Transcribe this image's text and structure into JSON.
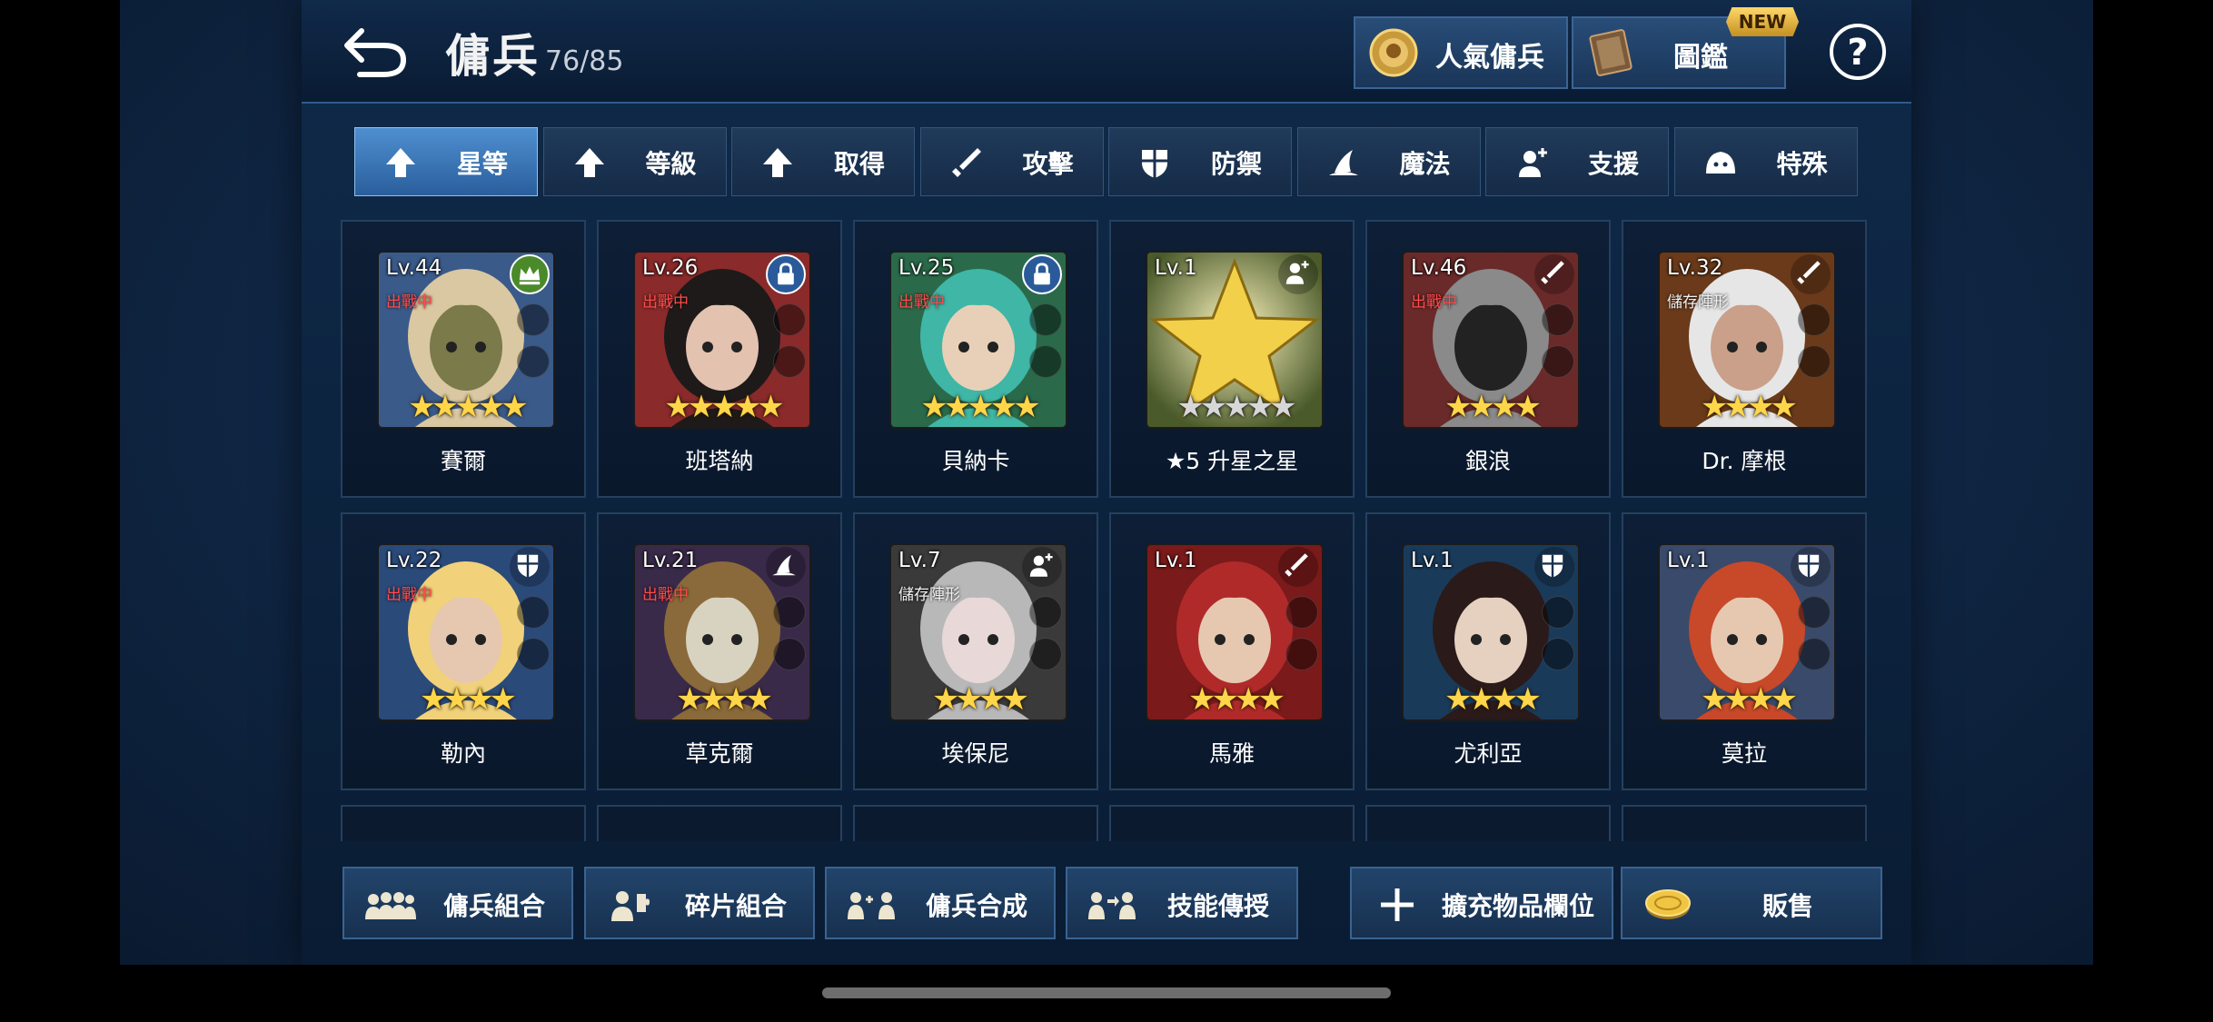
{
  "header": {
    "title": "傭兵",
    "count": "76/85"
  },
  "top_buttons": {
    "popular": "人氣傭兵",
    "codex": "圖鑑",
    "new_badge": "NEW",
    "help": "?"
  },
  "filters": [
    {
      "label": "星等",
      "icon": "arrow-up-icon",
      "active": true
    },
    {
      "label": "等級",
      "icon": "arrow-up-icon"
    },
    {
      "label": "取得",
      "icon": "arrow-up-icon"
    },
    {
      "label": "攻擊",
      "icon": "sword-icon"
    },
    {
      "label": "防禦",
      "icon": "shield-icon"
    },
    {
      "label": "魔法",
      "icon": "wizard-hat-icon"
    },
    {
      "label": "支援",
      "icon": "support-icon"
    },
    {
      "label": "特殊",
      "icon": "slime-icon"
    }
  ],
  "cards": [
    {
      "name": "賽爾",
      "level": "Lv.44",
      "status": "出戰中",
      "stars": "★★★★★",
      "badge": "crown-icon"
    },
    {
      "name": "班塔納",
      "level": "Lv.26",
      "status": "出戰中",
      "stars": "★★★★★",
      "badge": "lock-icon"
    },
    {
      "name": "貝納卡",
      "level": "Lv.25",
      "status": "出戰中",
      "stars": "★★★★★",
      "badge": "lock-icon"
    },
    {
      "name": "★5 升星之星",
      "level": "Lv.1",
      "status": "",
      "stars": "★★★★★",
      "badge": "support-icon"
    },
    {
      "name": "銀浪",
      "level": "Lv.46",
      "status": "出戰中",
      "stars": "★★★★",
      "badge": "sword-icon"
    },
    {
      "name": "Dr. 摩根",
      "level": "Lv.32",
      "status": "儲存陣形",
      "stars": "★★★★",
      "badge": "sword-icon"
    },
    {
      "name": "勒內",
      "level": "Lv.22",
      "status": "出戰中",
      "stars": "★★★★",
      "badge": "shield-icon"
    },
    {
      "name": "草克爾",
      "level": "Lv.21",
      "status": "出戰中",
      "stars": "★★★★",
      "badge": "wizard-hat-icon"
    },
    {
      "name": "埃保尼",
      "level": "Lv.7",
      "status": "儲存陣形",
      "stars": "★★★★",
      "badge": "support-icon"
    },
    {
      "name": "馬雅",
      "level": "Lv.1",
      "status": "",
      "stars": "★★★★",
      "badge": "sword-icon"
    },
    {
      "name": "尤利亞",
      "level": "Lv.1",
      "status": "",
      "stars": "★★★★",
      "badge": "shield-icon"
    },
    {
      "name": "莫拉",
      "level": "Lv.1",
      "status": "",
      "stars": "★★★★",
      "badge": "shield-icon"
    }
  ],
  "bottom_buttons": [
    {
      "label": "傭兵組合",
      "icon": "group-icon"
    },
    {
      "label": "碎片組合",
      "icon": "puzzle-icon"
    },
    {
      "label": "傭兵合成",
      "icon": "merge-icon"
    },
    {
      "label": "技能傳授",
      "icon": "skill-transfer-icon"
    },
    {
      "label": "擴充物品欄位",
      "icon": "plus-icon"
    },
    {
      "label": "販售",
      "icon": "coin-icon"
    }
  ],
  "colors": {
    "star_gold": "#ffd54a",
    "status_red": "#ff4b4b",
    "active_tab": "#4f8fd0"
  }
}
